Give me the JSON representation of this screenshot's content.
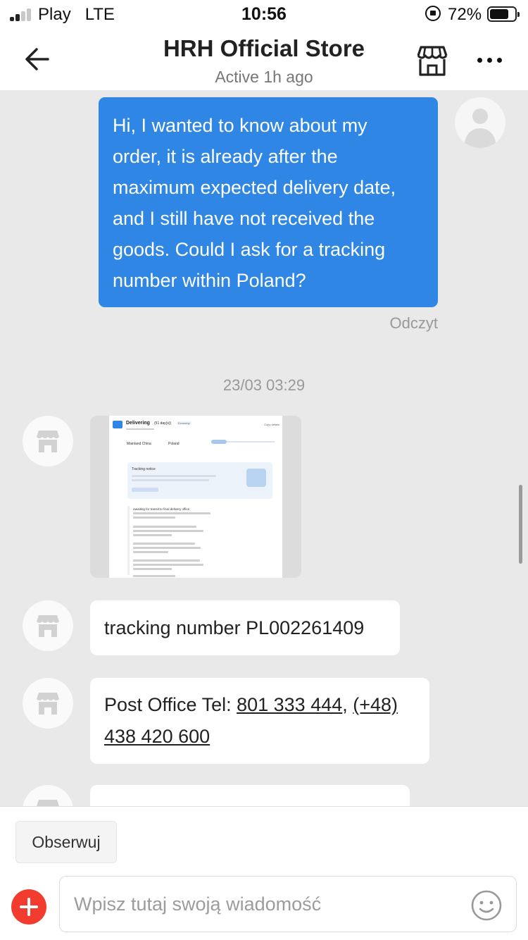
{
  "status_bar": {
    "carrier": "Play",
    "network": "LTE",
    "time": "10:56",
    "battery": "72%"
  },
  "header": {
    "title": "HRH Official Store",
    "subtitle": "Active 1h ago"
  },
  "messages": {
    "outgoing_1": {
      "lines": [
        "Hi, I wanted to know about my",
        "order, it is already after the",
        "maximum expected delivery date,",
        "and I still have not received the",
        "goods. Could I ask for a tracking",
        "number within Poland?"
      ],
      "status": "Odczyt"
    },
    "date_separator": "23/03 03:29",
    "image_screenshot": {
      "title": "Delivering",
      "days": "(51 day(s))",
      "tag": "Economy",
      "copy": "Copy details",
      "origin": "Mainland China",
      "destination": "Poland",
      "notice": "Tracking notice",
      "latest": "Awaiting for transit to final delivery office"
    },
    "tracking": {
      "text": "tracking number PL002261409"
    },
    "post_office": {
      "prefix": "Post Office Tel: ",
      "phone1": "801 333 444",
      "sep": ", ",
      "phone2_a": "(+48)",
      "phone2_b": "438 420 600"
    }
  },
  "bottom": {
    "follow_label": "Obserwuj",
    "input_placeholder": "Wpisz tutaj swoją wiadomość"
  },
  "colors": {
    "outgoing_bubble": "#2f86e5",
    "add_button": "#f23c2f",
    "chat_bg": "#e9e9e9"
  },
  "icons": [
    "back-arrow-icon",
    "storefront-icon",
    "more-dots-icon",
    "user-avatar-icon",
    "store-avatar-icon",
    "plus-icon",
    "emoji-icon"
  ]
}
